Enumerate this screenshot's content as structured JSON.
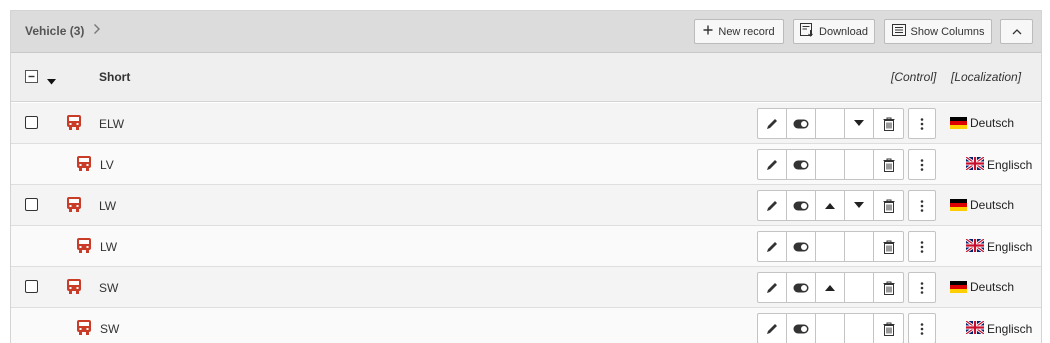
{
  "header": {
    "title": "Vehicle (3)",
    "new_record": "New record",
    "download": "Download",
    "show_columns": "Show Columns"
  },
  "columns": {
    "short": "Short",
    "control": "[Control]",
    "localization": "[Localization]"
  },
  "rows": [
    {
      "short": "ELW",
      "type": "parent",
      "lang": "Deutsch",
      "flag": "de-flag-icon",
      "move_up": false,
      "move_down": true
    },
    {
      "short": "LV",
      "type": "child",
      "lang": "Englisch",
      "flag": "uk-flag-icon"
    },
    {
      "short": "LW",
      "type": "parent",
      "lang": "Deutsch",
      "flag": "de-flag-icon",
      "move_up": true,
      "move_down": true
    },
    {
      "short": "LW",
      "type": "child",
      "lang": "Englisch",
      "flag": "uk-flag-icon"
    },
    {
      "short": "SW",
      "type": "parent",
      "lang": "Deutsch",
      "flag": "de-flag-icon",
      "move_up": true,
      "move_down": false
    },
    {
      "short": "SW",
      "type": "child",
      "lang": "Englisch",
      "flag": "uk-flag-icon"
    }
  ],
  "colors": {
    "vehicle_icon": "#c83c28",
    "header_bg": "#dcdcdc"
  }
}
